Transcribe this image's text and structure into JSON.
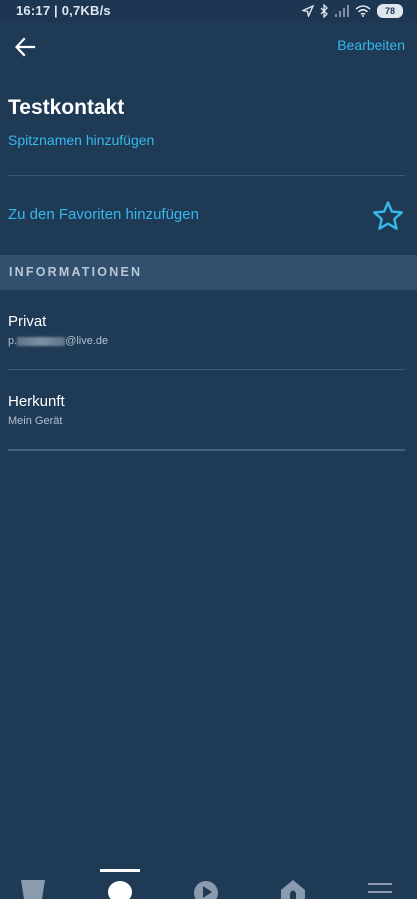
{
  "status_bar": {
    "time": "16:17",
    "speed": "0,7KB/s",
    "battery": "78",
    "icons": [
      "location-icon",
      "bluetooth-icon",
      "signal-icon",
      "wifi-icon",
      "battery-icon"
    ]
  },
  "header": {
    "back_icon": "arrow-left-icon",
    "edit_label": "Bearbeiten"
  },
  "contact": {
    "name": "Testkontakt",
    "nickname_action": "Spitznamen hinzufügen",
    "favorite_action": "Zu den Favoriten hinzufügen",
    "favorite_icon": "star-outline-icon"
  },
  "section": {
    "title": "INFORMATIONEN"
  },
  "info": [
    {
      "label": "Privat",
      "value_prefix": "p.",
      "value_suffix": "@live.de"
    },
    {
      "label": "Herkunft",
      "value": "Mein Gerät"
    }
  ],
  "bottom_nav": {
    "items": [
      "home-icon",
      "communicate-icon",
      "play-icon",
      "devices-icon",
      "more-icon"
    ],
    "active": "communicate-icon"
  },
  "colors": {
    "background": "#1f3a55",
    "accent": "#36b8ec",
    "section_header": "#32506e"
  }
}
